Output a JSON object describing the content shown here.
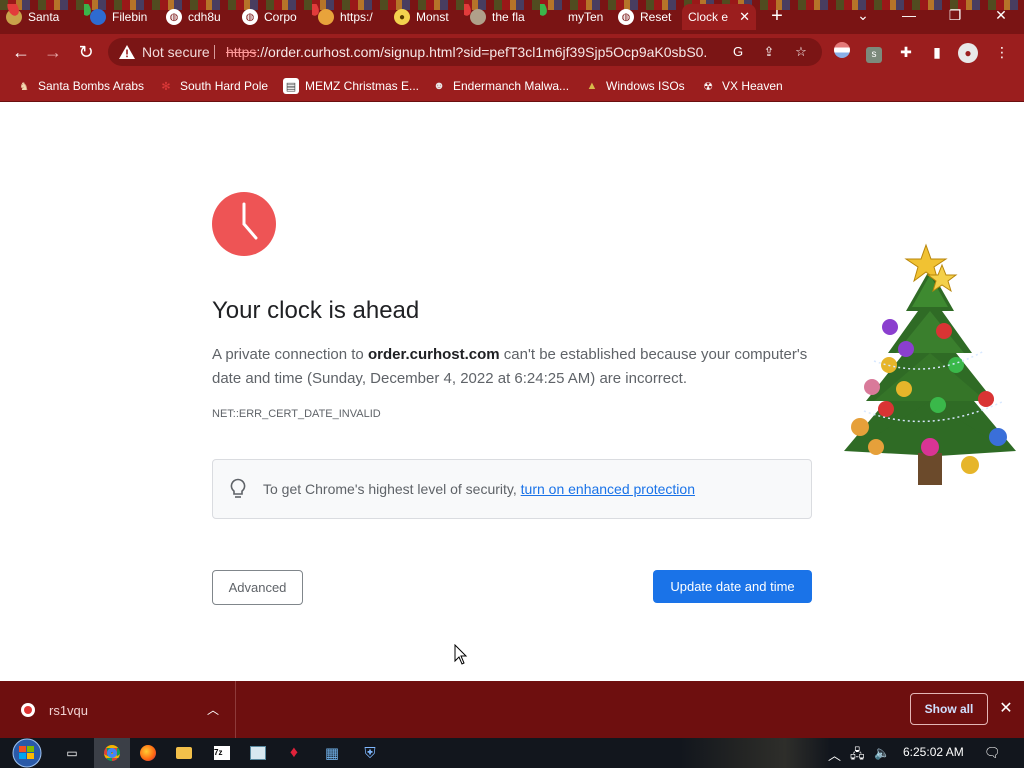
{
  "tabs": [
    {
      "label": "Santa",
      "active": false
    },
    {
      "label": "Filebin",
      "active": false
    },
    {
      "label": "cdh8u",
      "active": false
    },
    {
      "label": "Corpo",
      "active": false
    },
    {
      "label": "https:/",
      "active": false
    },
    {
      "label": "Monst",
      "active": false
    },
    {
      "label": "the fla",
      "active": false
    },
    {
      "label": "myTen",
      "active": false
    },
    {
      "label": "Reset",
      "active": false
    },
    {
      "label": "Clock e",
      "active": true
    }
  ],
  "address_bar": {
    "security_label": "Not secure",
    "url_scheme": "https",
    "url_rest": "://order.curhost.com/signup.html?sid=pefT3cl1m6jf39Sjp5Ocp9aK0sbS0..."
  },
  "bookmarks": [
    {
      "label": "Santa Bombs Arabs",
      "icon": "santa-icon"
    },
    {
      "label": "South Hard Pole",
      "icon": "snowflake-icon"
    },
    {
      "label": "MEMZ Christmas E...",
      "icon": "memz-icon"
    },
    {
      "label": "Endermanch Malwa...",
      "icon": "raccoon-icon"
    },
    {
      "label": "Windows ISOs",
      "icon": "tree-icon"
    },
    {
      "label": "VX Heaven",
      "icon": "vx-icon"
    }
  ],
  "error_page": {
    "heading": "Your clock is ahead",
    "desc_prefix": "A private connection to ",
    "domain": "order.curhost.com",
    "desc_suffix": " can't be established because your computer's date and time (Sunday, December 4, 2022 at 6:24:25 AM) are incorrect.",
    "error_code": "NET::ERR_CERT_DATE_INVALID",
    "enhanced_prefix": "To get Chrome's highest level of security, ",
    "enhanced_link": "turn on enhanced protection",
    "advanced_label": "Advanced",
    "update_label": "Update date and time"
  },
  "download_bar": {
    "filename": "rs1vqu",
    "show_all_label": "Show all"
  },
  "taskbar": {
    "clock": "6:25:02 AM",
    "apps": [
      "task-view",
      "chrome",
      "firefox",
      "file-explorer",
      "7zip",
      "notepad",
      "app-red",
      "app-network",
      "app-shield"
    ]
  },
  "colors": {
    "theme_frame": "#7a1414",
    "theme_toolbar": "#9b1e1e",
    "download_bar": "#6e0f0f",
    "accent_blue": "#1a73e8",
    "clock_red": "#ee5455"
  }
}
